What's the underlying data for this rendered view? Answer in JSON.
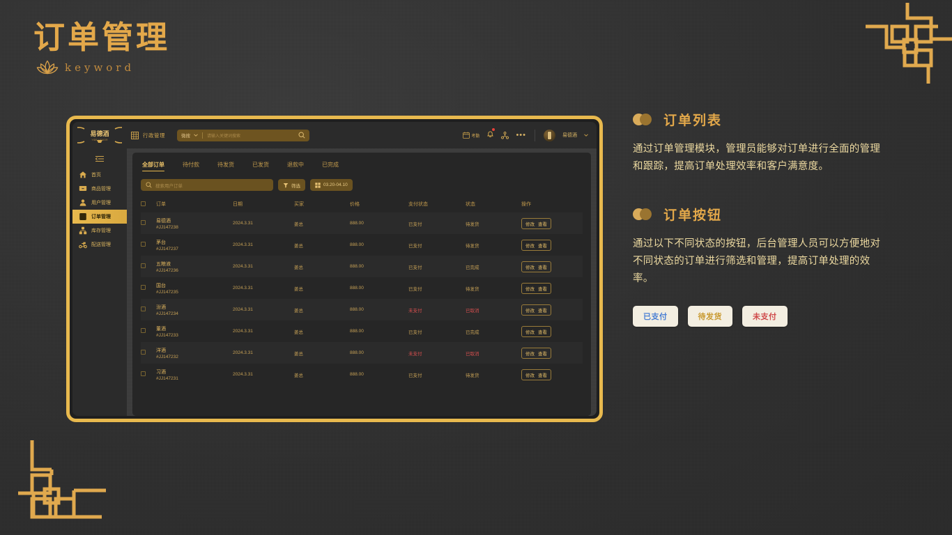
{
  "page": {
    "title": "订单管理",
    "keyword": "keyword"
  },
  "colors": {
    "gold": "#e3a84a",
    "gold_bright": "#e8b94e",
    "cream": "#f3eee1",
    "text_body": "#ecd9a0",
    "status_paid": "#4a7fd4",
    "status_pending": "#c8992f",
    "status_unpaid": "#cf4a4a",
    "danger": "#d94f4f",
    "bg": "#323232"
  },
  "app": {
    "logo_text": "易德酒",
    "topbar": {
      "grid_icon": "grid-icon",
      "module_label": "行政管理",
      "search": {
        "scope": "微搜",
        "chevron_icon": "chevron-down-icon",
        "placeholder": "请输入关键词搜索",
        "search_icon": "search-icon"
      },
      "attendance_label": "考勤",
      "attendance_icon": "calendar-icon",
      "bell_icon": "bell-icon",
      "share_icon": "share-nodes-icon",
      "more_icon": "ellipsis-icon",
      "avatar_icon": "avatar",
      "user_name": "易德酒",
      "user_chevron_icon": "chevron-down-icon"
    },
    "sidebar": {
      "toggle_icon": "menu-collapse-icon",
      "items": [
        {
          "label": "首页",
          "icon": "home-icon",
          "active": false
        },
        {
          "label": "商品管理",
          "icon": "box-icon",
          "active": false
        },
        {
          "label": "用户管理",
          "icon": "user-icon",
          "active": false
        },
        {
          "label": "订单管理",
          "icon": "order-icon",
          "active": true
        },
        {
          "label": "库存管理",
          "icon": "warehouse-icon",
          "active": false
        },
        {
          "label": "配送管理",
          "icon": "scooter-icon",
          "active": false
        }
      ]
    },
    "tabs": [
      {
        "label": "全部订单",
        "active": true
      },
      {
        "label": "待付款",
        "active": false
      },
      {
        "label": "待发货",
        "active": false
      },
      {
        "label": "已发货",
        "active": false
      },
      {
        "label": "退款中",
        "active": false
      },
      {
        "label": "已完成",
        "active": false
      }
    ],
    "filters": {
      "search_icon": "search-icon",
      "search_placeholder": "搜索用户订单",
      "filter_icon": "filter-icon",
      "filter_label": "筛选",
      "date_icon": "calendar-grid-icon",
      "date_range": "03.20-04.10"
    },
    "table": {
      "select_all_icon": "checkbox-icon",
      "headers": [
        "订单",
        "日期",
        "买家",
        "价格",
        "支付状态",
        "状态",
        "操作"
      ],
      "actions": {
        "edit": "修改",
        "view": "查看"
      },
      "rows": [
        {
          "product": "易德酒",
          "order_id": "#JJ147238",
          "date": "2024.3.31",
          "buyer": "姜总",
          "price": "888.00",
          "pay_status": "已支付",
          "pay_alert": false,
          "status": "待发货",
          "status_alert": false
        },
        {
          "product": "茅台",
          "order_id": "#JJ147237",
          "date": "2024.3.31",
          "buyer": "姜总",
          "price": "888.00",
          "pay_status": "已支付",
          "pay_alert": false,
          "status": "待发货",
          "status_alert": false
        },
        {
          "product": "五粮液",
          "order_id": "#JJ147236",
          "date": "2024.3.31",
          "buyer": "姜总",
          "price": "888.00",
          "pay_status": "已支付",
          "pay_alert": false,
          "status": "已完成",
          "status_alert": false
        },
        {
          "product": "国台",
          "order_id": "#JJ147235",
          "date": "2024.3.31",
          "buyer": "姜总",
          "price": "888.00",
          "pay_status": "已支付",
          "pay_alert": false,
          "status": "待发货",
          "status_alert": false
        },
        {
          "product": "汾酒",
          "order_id": "#JJ147234",
          "date": "2024.3.31",
          "buyer": "姜总",
          "price": "888.00",
          "pay_status": "未支付",
          "pay_alert": true,
          "status": "已取消",
          "status_alert": true
        },
        {
          "product": "董酒",
          "order_id": "#JJ147233",
          "date": "2024.3.31",
          "buyer": "姜总",
          "price": "888.00",
          "pay_status": "已支付",
          "pay_alert": false,
          "status": "已完成",
          "status_alert": false
        },
        {
          "product": "洋酒",
          "order_id": "#JJ147232",
          "date": "2024.3.31",
          "buyer": "姜总",
          "price": "888.00",
          "pay_status": "未支付",
          "pay_alert": true,
          "status": "已取消",
          "status_alert": true
        },
        {
          "product": "习酒",
          "order_id": "#JJ147231",
          "date": "2024.3.31",
          "buyer": "姜总",
          "price": "888.00",
          "pay_status": "已支付",
          "pay_alert": false,
          "status": "待发货",
          "status_alert": false
        }
      ]
    }
  },
  "info": {
    "section1": {
      "title": "订单列表",
      "body": "通过订单管理模块，管理员能够对订单进行全面的管理和跟踪，提高订单处理效率和客户满意度。"
    },
    "section2": {
      "title": "订单按钮",
      "body": "通过以下不同状态的按钮，后台管理人员可以方便地对不同状态的订单进行筛选和管理，提高订单处理的效率。",
      "buttons": [
        {
          "label": "已支付",
          "color": "#4a7fd4"
        },
        {
          "label": "待发货",
          "color": "#c8992f"
        },
        {
          "label": "未支付",
          "color": "#cf4a4a"
        }
      ]
    }
  }
}
